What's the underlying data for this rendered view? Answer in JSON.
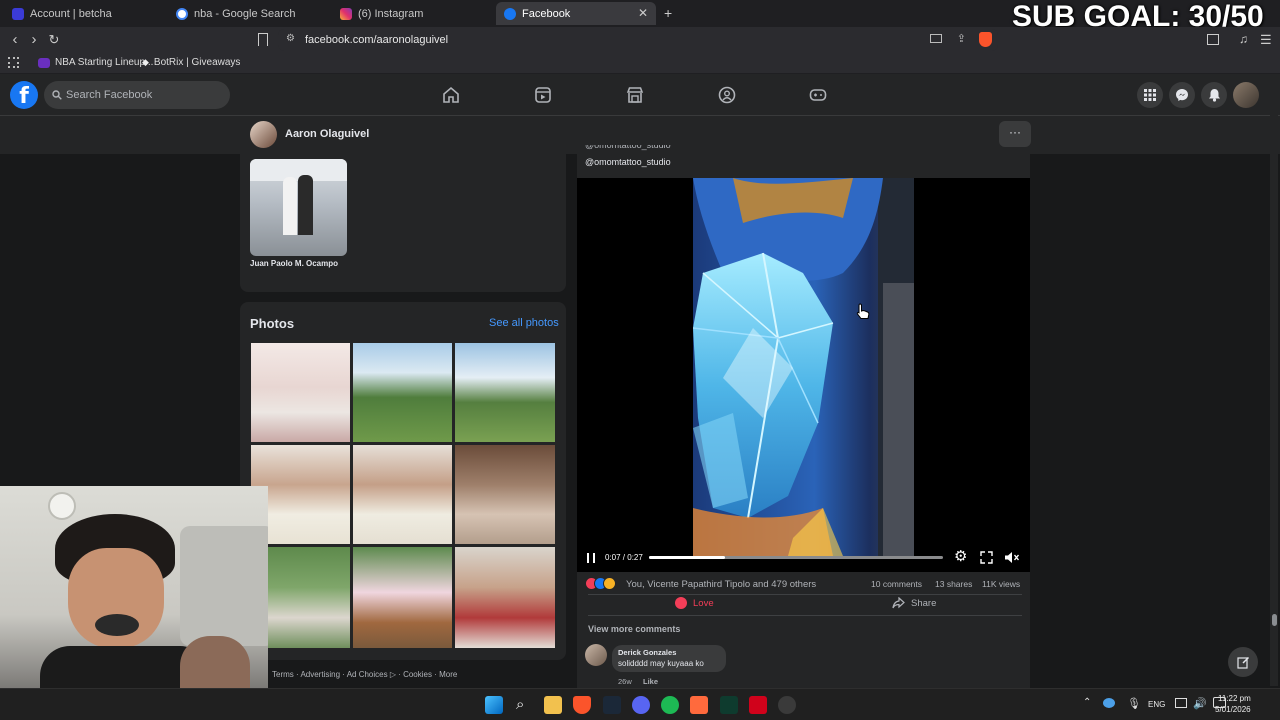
{
  "browser": {
    "tabs": [
      {
        "label": "Account | betcha",
        "active": false
      },
      {
        "label": "nba - Google Search",
        "active": false
      },
      {
        "label": "(6) Instagram",
        "active": false
      },
      {
        "label": "Facebook",
        "active": true
      }
    ],
    "url": "facebook.com/aaronolaguivel",
    "bookmarks": [
      "NBA Starting Lineup...",
      "BotRix | Giveaways"
    ]
  },
  "overlay": {
    "sub_goal": "SUB GOAL: 30/50"
  },
  "facebook": {
    "search_placeholder": "Search Facebook",
    "profile_name": "Aaron Olaguivel",
    "friend": {
      "name": "Juan Paolo M. Ocampo"
    },
    "photos": {
      "title": "Photos",
      "see_all": "See all photos"
    },
    "footer_links": "Terms · Advertising · Ad Choices ▷ · Cookies · More"
  },
  "post": {
    "caption_line": "@omomtattoo_studio",
    "video": {
      "time": "0:07 / 0:27",
      "progress": 0.26
    },
    "reactions_text": "You, Vicente Papathird Tipolo and 479 others",
    "comments_count": "10 comments",
    "shares_count": "13 shares",
    "views_count": "11K views",
    "love_label": "Love",
    "share_label": "Share",
    "view_more": "View more comments",
    "comment": {
      "author": "Derick Gonzales",
      "text": "solidddd may kuyaaa ko",
      "age": "26w",
      "like": "Like"
    }
  },
  "taskbar": {
    "lang": "ENG",
    "time": "11:22 pm",
    "date": "5/01/2026"
  }
}
